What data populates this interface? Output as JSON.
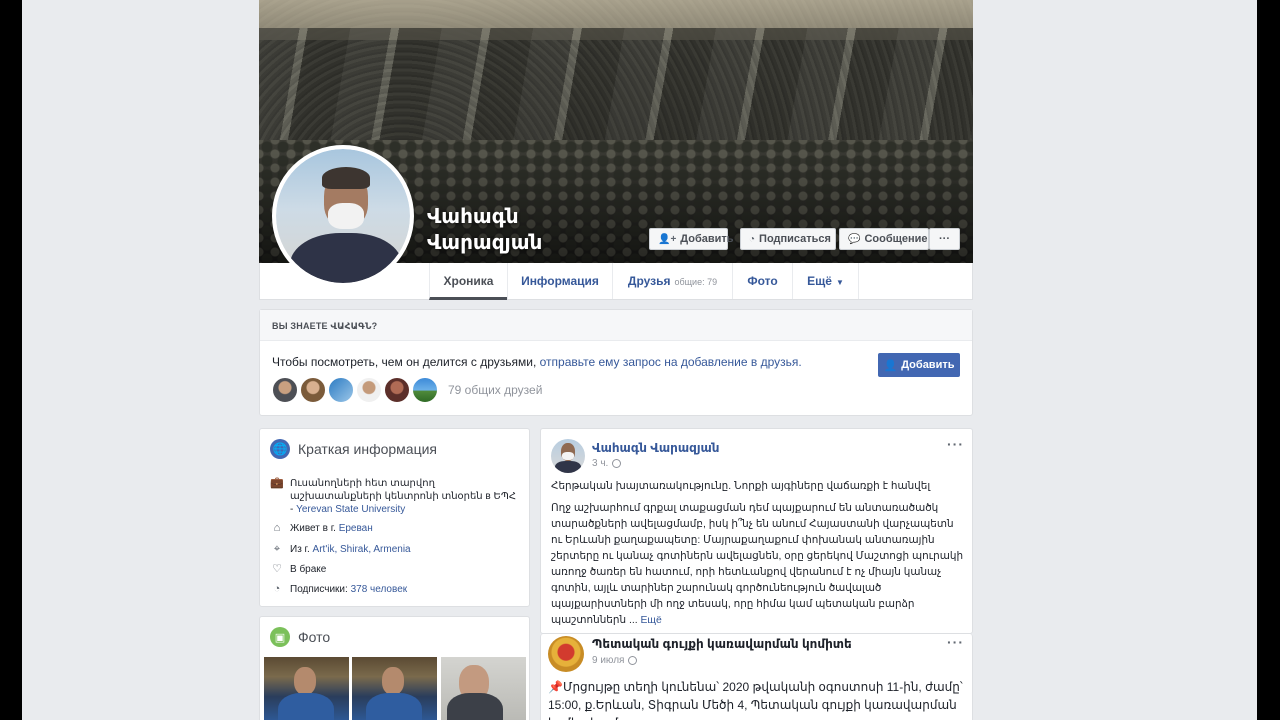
{
  "profile": {
    "name_line1": "Վահագն",
    "name_line2": "Վարազյան"
  },
  "cover_actions": {
    "add_friend": "Добавить",
    "subscribe": "Подписаться",
    "message": "Сообщение",
    "more": "···"
  },
  "tabs": {
    "timeline": "Хроника",
    "about": "Информация",
    "friends": "Друзья",
    "friends_count": "общие: 79",
    "photos": "Фото",
    "more": "Ещё"
  },
  "know": {
    "title": "ВЫ ЗНАЕТЕ ՎԱՀԱԳՆ?",
    "text": "Чтобы посмотреть, чем он делится с друзьями, ",
    "link": "отправьте ему запрос на добавление в друзья.",
    "add_button": "Добавить",
    "mutual": "79 общих друзей"
  },
  "intro": {
    "title": "Краткая информация",
    "work_text": "Ուսանողների հետ տարվող աշխատանքների կենտրոնի տնօրեն в ԵՊՀ - ",
    "work_link": "Yerevan State University",
    "lives_prefix": "Живет в г. ",
    "lives_link": "Ереван",
    "from_prefix": "Из г. ",
    "from_link": "Art'ik, Shirak, Armenia",
    "relationship": "В браке",
    "followers_prefix": "Подписчики: ",
    "followers_link": "378 человек"
  },
  "photos": {
    "title": "Фото"
  },
  "post1": {
    "author": "Վահագն Վարազյան",
    "time": "3 ч.",
    "line1": "Հերթական խայտառակությունը. Նորքի այգիները վաճառքի է հանվել",
    "body": "Ողջ աշխարհում գրքալ տաքացման դեմ պայքարում են անտառածածկ տարածքների ավելացմամբ, իսկ ի՞նչ են անում Հայաստանի վարչապետն ու Երևանի քաղաքապետը: Մայրաքաղաքում փոխանակ անտառային շերտերը ու կանաչ գոտիներն ավելացնեն, օրը ցերեկով Մաշտոցի պուրակի առողջ ծառեր են հատում, որի հետևանքով վերանում է ոչ միայն կանաչ գոտին, այլև տարիներ շարունակ գործունեություն ծավալած պայքարիստների մի ողջ տեսակ, որը հիմա կամ պետական բարձր պաշտոններն ... ",
    "more": "Ещё",
    "menu": "···"
  },
  "post2": {
    "author": "Պետական գույքի կառավարման կոմիտե",
    "time": "9 июля",
    "text": "Մրցույթը տեղի կունենա՝ 2020 թվականի  օգոստոսի 11-ին, ժամը՝ 15:00, ք.Երևան, Տիգրան Մեծի 4, Պետական գույքի կառավարման կոմիտեում",
    "pin": "📌",
    "menu": "···"
  },
  "colors": {
    "link": "#365899",
    "primary_button": "#4267b2",
    "page_bg": "#e9ebee"
  },
  "icons": [
    "user-plus-icon",
    "rss-icon",
    "messenger-icon",
    "globe-icon",
    "briefcase-icon",
    "home-icon",
    "location-pin-icon",
    "heart-icon",
    "followers-icon",
    "photo-icon",
    "privacy-globe-icon",
    "pin-icon"
  ]
}
